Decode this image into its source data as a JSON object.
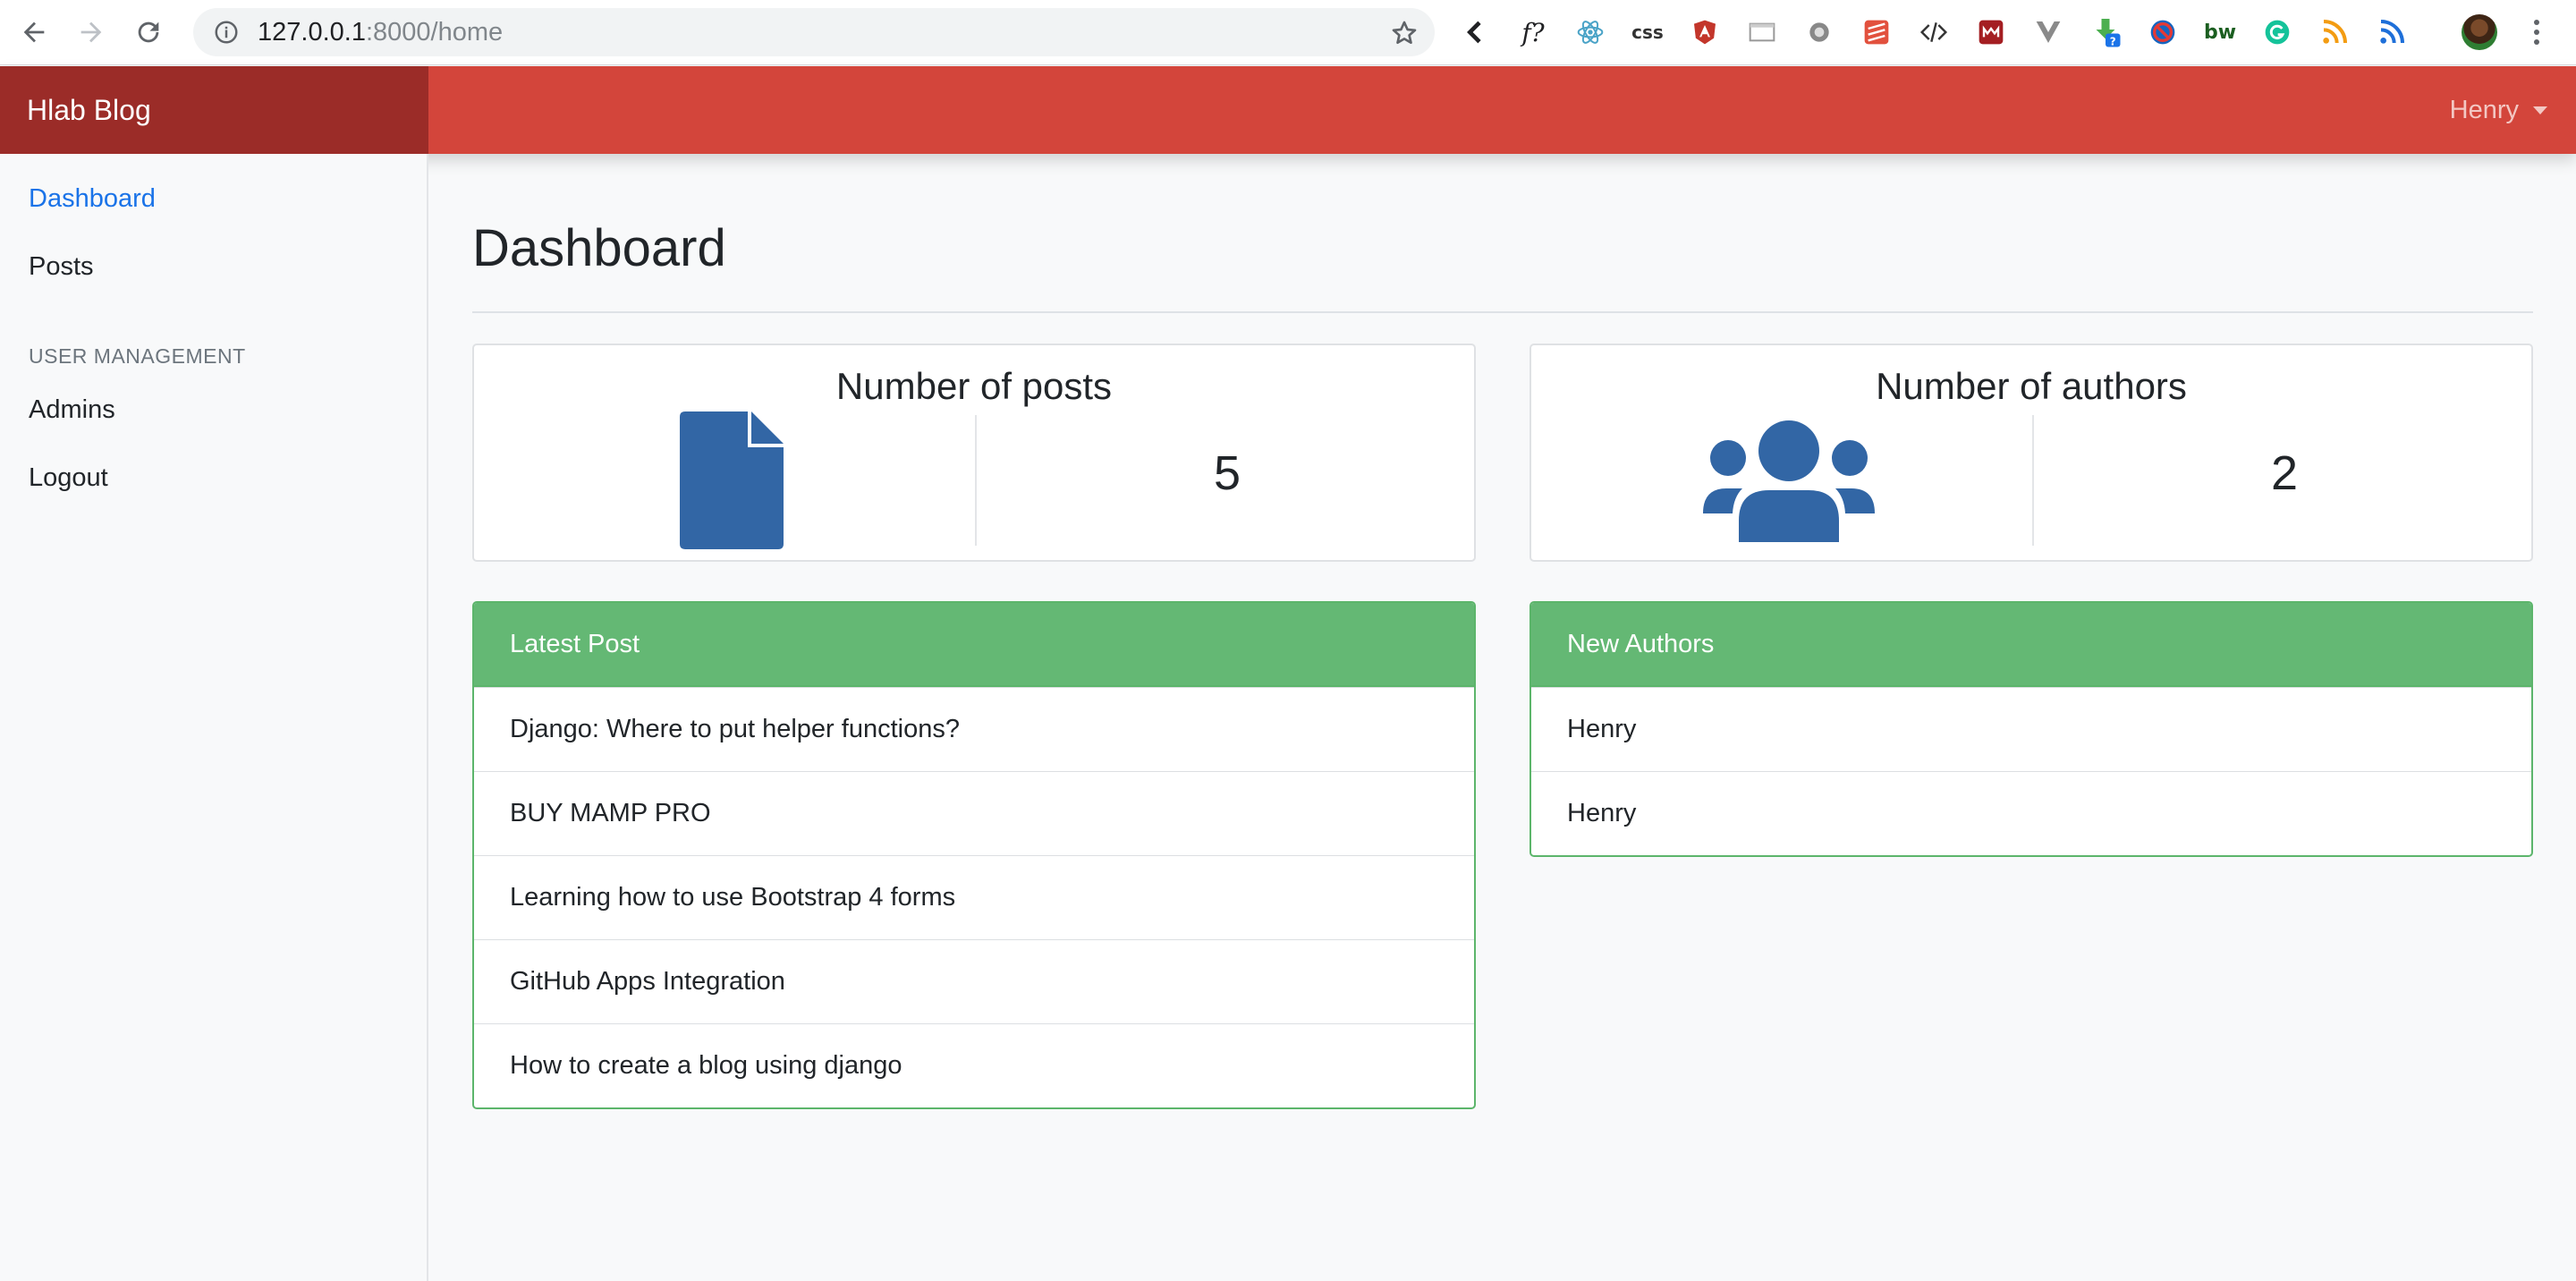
{
  "browser": {
    "url_host": "127.0.0.1",
    "url_path": ":8000/home",
    "extensions": [
      "back-chevron",
      "f?",
      "react",
      "css",
      "angular",
      "window",
      "gear",
      "stack",
      "code",
      "m",
      "vue",
      "download-badge",
      "block",
      "bw",
      "grammarly",
      "rss",
      "rss"
    ],
    "ext_fx_label": "f?",
    "ext_css_label": "css",
    "ext_bw_label": "bw"
  },
  "navbar": {
    "brand": "Hlab Blog",
    "user": "Henry"
  },
  "sidebar": {
    "items": [
      {
        "label": "Dashboard",
        "active": true
      },
      {
        "label": "Posts"
      }
    ],
    "section_heading": "USER MANAGEMENT",
    "section_items": [
      {
        "label": "Admins"
      },
      {
        "label": "Logout"
      }
    ]
  },
  "main": {
    "title": "Dashboard",
    "stats": [
      {
        "title": "Number of posts",
        "value": "5",
        "icon": "file-icon"
      },
      {
        "title": "Number of authors",
        "value": "2",
        "icon": "users-icon"
      }
    ],
    "latest_posts": {
      "header": "Latest Post",
      "items": [
        "Django: Where to put helper functions?",
        "BUY MAMP PRO",
        "Learning how to use Bootstrap 4 forms",
        "GitHub Apps Integration",
        "How to create a blog using django"
      ]
    },
    "new_authors": {
      "header": "New Authors",
      "items": [
        "Henry",
        "Henry"
      ]
    }
  },
  "colors": {
    "navbar": "#d3453b",
    "brand_bg": "#9b2c28",
    "panel_header": "#64b874",
    "icon_blue": "#3266a5",
    "link_active": "#1a73e8"
  }
}
